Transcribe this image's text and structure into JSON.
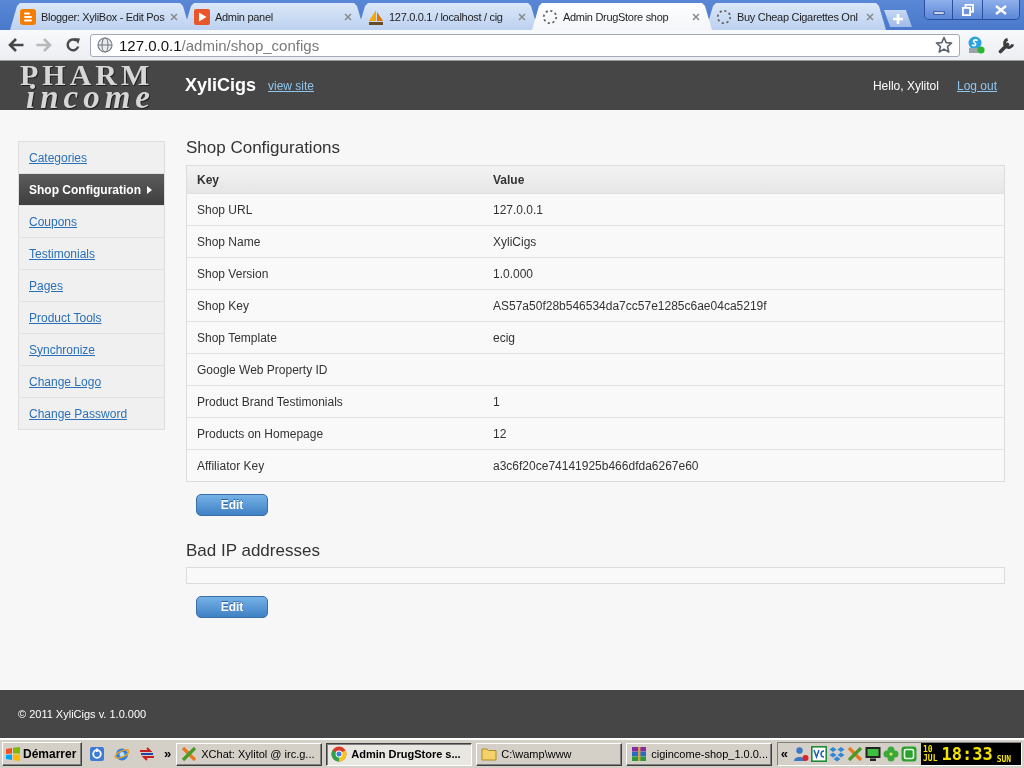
{
  "browser": {
    "tabs": [
      {
        "title": "Blogger: XyliBox - Edit Pos",
        "kind": "blogger",
        "selected": false
      },
      {
        "title": "Admin panel",
        "kind": "panel",
        "selected": false
      },
      {
        "title": "127.0.0.1 / localhost / cig",
        "kind": "pma",
        "selected": false
      },
      {
        "title": "Admin DrugStore shop",
        "kind": "loading",
        "selected": true
      },
      {
        "title": "Buy Cheap Cigarettes Onl",
        "kind": "loading",
        "selected": false
      }
    ],
    "address": {
      "host": "127.0.0.1",
      "path": "/admin/shop_configs"
    }
  },
  "header": {
    "logo": {
      "line_1": "PHARM",
      "line_2": "income"
    },
    "site_name": "XyliCigs",
    "view_site_link": "view site",
    "greeting": "Hello, Xylitol",
    "logout_link": "Log out"
  },
  "sidebar": {
    "items": [
      {
        "label": "Categories",
        "selected": false
      },
      {
        "label": "Shop Configuration",
        "selected": true
      },
      {
        "label": "Coupons",
        "selected": false
      },
      {
        "label": "Testimonials",
        "selected": false
      },
      {
        "label": "Pages",
        "selected": false
      },
      {
        "label": "Product Tools",
        "selected": false
      },
      {
        "label": "Synchronize",
        "selected": false
      },
      {
        "label": "Change Logo",
        "selected": false
      },
      {
        "label": "Change Password",
        "selected": false
      }
    ]
  },
  "sections": [
    {
      "kind": "table",
      "title": "Shop Configurations",
      "columns": [
        "Key",
        "Value"
      ],
      "rows": [
        {
          "key": "Shop URL",
          "value": "127.0.0.1"
        },
        {
          "key": "Shop Name",
          "value": "XyliCigs"
        },
        {
          "key": "Shop Version",
          "value": "1.0.000"
        },
        {
          "key": "Shop Key",
          "value": "AS57a50f28b546534da7cc57e1285c6ae04ca5219f"
        },
        {
          "key": "Shop Template",
          "value": "ecig"
        },
        {
          "key": "Google Web Property ID"
        },
        {
          "key": "Product Brand Testimonials",
          "value": "1"
        },
        {
          "key": "Products on Homepage",
          "value": "12"
        },
        {
          "key": "Affiliator Key",
          "value": "a3c6f20ce74141925b466dfda6267e60"
        }
      ],
      "button": "Edit"
    },
    {
      "kind": "empty_list",
      "title": "Bad IP addresses",
      "button": "Edit"
    }
  ],
  "footer": {
    "copyright": "© 2011 XyliCigs v. 1.0.000"
  },
  "taskbar": {
    "start_label": "Démarrer",
    "quick_launch_more": "»",
    "tasks": [
      {
        "label": "XChat: Xylitol @ irc.g...",
        "kind": "chat",
        "selected": false
      },
      {
        "label": "Admin DrugStore s...",
        "kind": "browser",
        "selected": true
      },
      {
        "label": "C:\\wamp\\www",
        "kind": "folder",
        "selected": false
      },
      {
        "label": "cigincome-shop_1.0.0...",
        "kind": "archive",
        "selected": false
      }
    ],
    "tray_expand": "«",
    "clock": {
      "day": "10",
      "month": "JUL",
      "time": "18:33",
      "weekday": "SUN"
    }
  }
}
